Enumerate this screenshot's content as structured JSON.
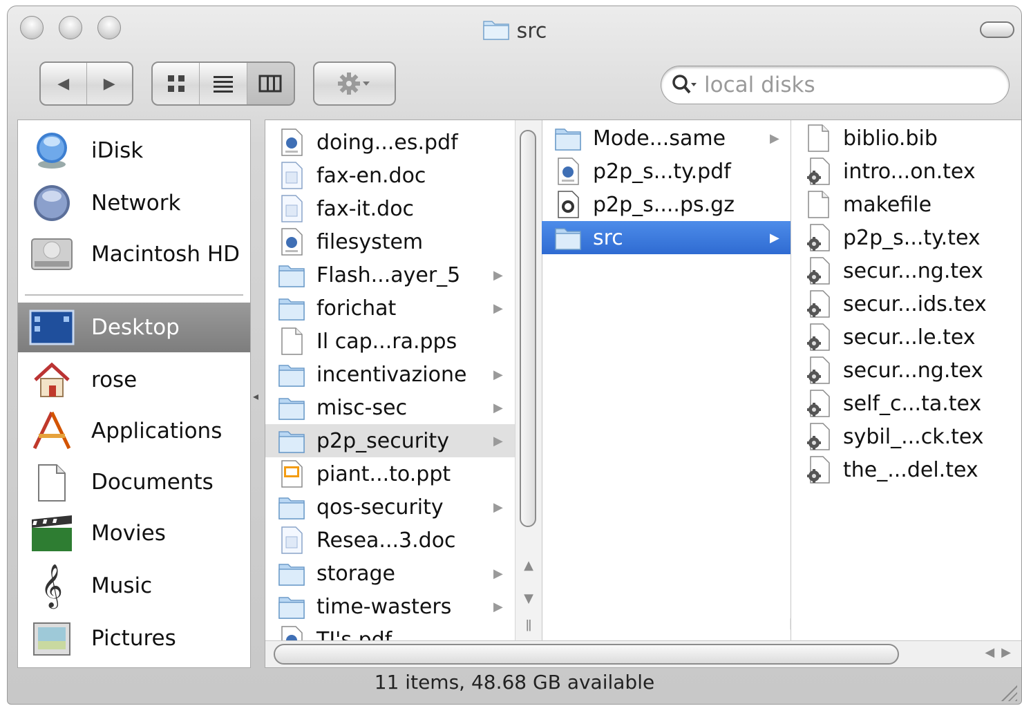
{
  "window": {
    "title": "src",
    "status": "11 items, 48.68 GB available"
  },
  "toolbar": {
    "back_glyph": "◀",
    "forward_glyph": "▶",
    "search_placeholder": "local disks"
  },
  "sidebar": {
    "devices": [
      {
        "label": "iDisk",
        "icon": "idisk-icon"
      },
      {
        "label": "Network",
        "icon": "network-globe-icon"
      },
      {
        "label": "Macintosh HD",
        "icon": "hard-disk-icon"
      }
    ],
    "places": [
      {
        "label": "Desktop",
        "icon": "desktop-icon",
        "selected": true
      },
      {
        "label": "rose",
        "icon": "home-icon"
      },
      {
        "label": "Applications",
        "icon": "applications-icon"
      },
      {
        "label": "Documents",
        "icon": "documents-icon"
      },
      {
        "label": "Movies",
        "icon": "movies-clapper-icon"
      },
      {
        "label": "Music",
        "icon": "music-clef-icon"
      },
      {
        "label": "Pictures",
        "icon": "pictures-icon"
      }
    ]
  },
  "columns": {
    "col1": [
      {
        "label": "doing...es.pdf",
        "icon": "pdf-file-icon"
      },
      {
        "label": "fax-en.doc",
        "icon": "doc-file-icon"
      },
      {
        "label": "fax-it.doc",
        "icon": "doc-file-icon"
      },
      {
        "label": "filesystem",
        "icon": "pdf-file-icon"
      },
      {
        "label": "Flash...ayer_5",
        "icon": "folder-icon",
        "folder": true
      },
      {
        "label": "forichat",
        "icon": "folder-icon",
        "folder": true
      },
      {
        "label": "Il cap...ra.pps",
        "icon": "blank-file-icon"
      },
      {
        "label": "incentivazione",
        "icon": "folder-icon",
        "folder": true
      },
      {
        "label": "misc-sec",
        "icon": "folder-icon",
        "folder": true
      },
      {
        "label": "p2p_security",
        "icon": "folder-icon",
        "folder": true,
        "highlight": true
      },
      {
        "label": "piant...to.ppt",
        "icon": "ppt-file-icon"
      },
      {
        "label": "qos-security",
        "icon": "folder-icon",
        "folder": true
      },
      {
        "label": "Resea...3.doc",
        "icon": "doc-file-icon"
      },
      {
        "label": "storage",
        "icon": "folder-icon",
        "folder": true
      },
      {
        "label": "time-wasters",
        "icon": "folder-icon",
        "folder": true
      },
      {
        "label": "TI's pdf",
        "icon": "pdf-file-icon"
      }
    ],
    "col2": [
      {
        "label": "Mode...same",
        "icon": "folder-icon",
        "folder": true
      },
      {
        "label": "p2p_s...ty.pdf",
        "icon": "pdf-file-icon"
      },
      {
        "label": "p2p_s....ps.gz",
        "icon": "gz-file-icon"
      },
      {
        "label": "src",
        "icon": "folder-icon",
        "folder": true,
        "selected": true
      }
    ],
    "col3": [
      {
        "label": "biblio.bib",
        "icon": "blank-file-icon"
      },
      {
        "label": "intro...on.tex",
        "icon": "tex-file-icon"
      },
      {
        "label": "makefile",
        "icon": "blank-file-icon"
      },
      {
        "label": "p2p_s...ty.tex",
        "icon": "tex-file-icon"
      },
      {
        "label": "secur...ng.tex",
        "icon": "tex-file-icon"
      },
      {
        "label": "secur...ids.tex",
        "icon": "tex-file-icon"
      },
      {
        "label": "secur...le.tex",
        "icon": "tex-file-icon"
      },
      {
        "label": "secur...ng.tex",
        "icon": "tex-file-icon"
      },
      {
        "label": "self_c...ta.tex",
        "icon": "tex-file-icon"
      },
      {
        "label": "sybil_...ck.tex",
        "icon": "tex-file-icon"
      },
      {
        "label": "the_...del.tex",
        "icon": "tex-file-icon"
      }
    ]
  }
}
